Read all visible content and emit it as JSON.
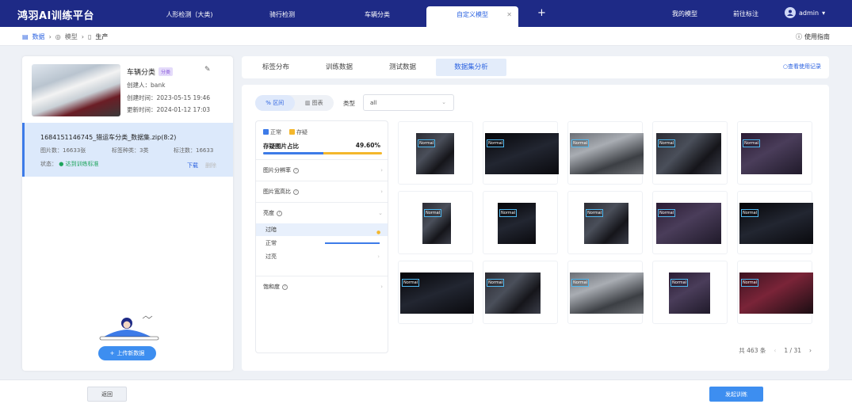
{
  "app": {
    "title": "鸿羽AI训练平台"
  },
  "nav": {
    "tabs": [
      {
        "label": "人形检测（大类)"
      },
      {
        "label": "骑行检测"
      },
      {
        "label": "车辆分类"
      },
      {
        "label": "自定义模型"
      }
    ],
    "add_icon": "plus-icon",
    "right_links": [
      {
        "label": "我的模型"
      },
      {
        "label": "前往标注"
      }
    ],
    "user": {
      "name": "admin",
      "chevron": "▾"
    }
  },
  "breadcrumb": {
    "items": [
      "数据",
      "模型",
      "生产"
    ]
  },
  "guide": {
    "label": "使用指南"
  },
  "dataset": {
    "name": "车辆分类",
    "tag": "分类",
    "creator": "创建人：bank",
    "created": "创建时间：2023-05-15 19:46",
    "updated": "更新时间：2024-01-12 17:03"
  },
  "version": {
    "name": "1684151146745_猎运车分类_数据集.zip(8:2)",
    "count": "图片数：16633张",
    "kinds": "标签种类：3类",
    "labeled": "标注数：16633",
    "status_label": "状态：",
    "status": "达到训练标准",
    "download": "下载",
    "delete": "删除"
  },
  "upload": {
    "label": "上传新数据"
  },
  "tabs": [
    {
      "label": "标签分布"
    },
    {
      "label": "训练数据"
    },
    {
      "label": "测试数据"
    },
    {
      "label": "数据集分析"
    }
  ],
  "tabs_link": "查看使用记录",
  "view_toggle": {
    "interval": "区间",
    "chart": "图表"
  },
  "type_filter": {
    "label": "类型",
    "value": "all"
  },
  "legend": {
    "normal": "正常",
    "suspect": "存疑"
  },
  "colors": {
    "normal": "#3d7be8",
    "suspect": "#f4b72c",
    "primary": "#2b62e0",
    "nav": "#1e2a86"
  },
  "suspect_ratio": {
    "label": "存疑图片占比",
    "value": "49.60%",
    "fraction": 0.496
  },
  "filters": [
    {
      "label": "图片分辨率"
    },
    {
      "label": "图片宽高比"
    },
    {
      "label": "亮度",
      "expanded": true
    },
    {
      "label": "饱和度"
    }
  ],
  "brightness": [
    {
      "label": "过暗",
      "level": "highlighted"
    },
    {
      "label": "正常",
      "level": "bar"
    },
    {
      "label": "过亮",
      "level": "none"
    }
  ],
  "images": [
    {
      "label": "Normal"
    },
    {
      "label": "Normal"
    },
    {
      "label": "Normal"
    },
    {
      "label": "Normal"
    },
    {
      "label": "Normal"
    },
    {
      "label": "Normal"
    },
    {
      "label": "Normal"
    },
    {
      "label": "Normal"
    },
    {
      "label": "Normal"
    },
    {
      "label": "Normal"
    },
    {
      "label": "Normal"
    },
    {
      "label": "Normal"
    },
    {
      "label": "Normal"
    },
    {
      "label": "Normal"
    },
    {
      "label": "Normal"
    }
  ],
  "pager": {
    "total": "共 463 条",
    "page": "1 / 31"
  },
  "footer": {
    "back": "返回",
    "train": "发起训练"
  }
}
